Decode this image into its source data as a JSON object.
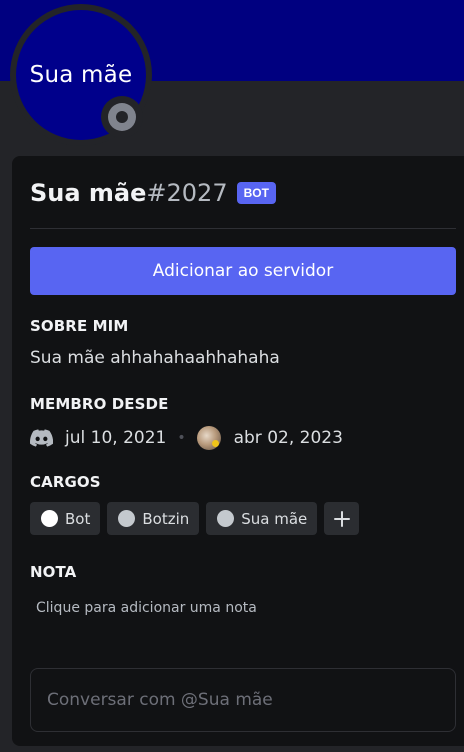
{
  "colors": {
    "banner": "#000080",
    "avatar_bg": "#00008b",
    "accent": "#5865f2",
    "status_offline": "#80848e",
    "card_bg": "#111214",
    "page_bg": "#232428"
  },
  "profile": {
    "avatar_text": "Sua mãe",
    "username": "Sua mãe",
    "discriminator": "#2027",
    "badge": "BOT",
    "status_icon": "offline-status-icon"
  },
  "actions": {
    "add_to_server": "Adicionar ao servidor"
  },
  "about": {
    "heading": "SOBRE MIM",
    "text": "Sua mãe ahhahahaahhahaha"
  },
  "member_since": {
    "heading": "MEMBRO DESDE",
    "discord_icon": "discord-icon",
    "discord_date": "jul 10, 2021",
    "separator": "•",
    "server_icon": "server-avatar",
    "server_date": "abr 02, 2023"
  },
  "roles": {
    "heading": "CARGOS",
    "items": [
      {
        "label": "Bot",
        "color": "#ffffff"
      },
      {
        "label": "Botzin",
        "color": "#c4c9ce"
      },
      {
        "label": "Sua mãe",
        "color": "#c4c9ce"
      }
    ],
    "add_icon": "plus-icon"
  },
  "note": {
    "heading": "NOTA",
    "placeholder": "Clique para adicionar uma nota"
  },
  "message": {
    "placeholder": "Conversar com @Sua mãe"
  }
}
